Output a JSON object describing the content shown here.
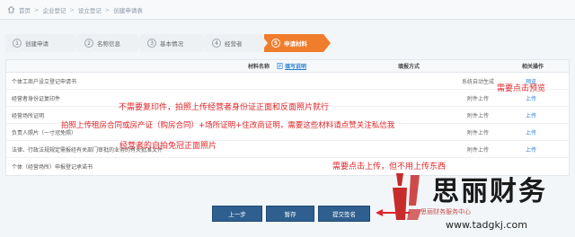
{
  "breadcrumb": {
    "items": [
      "首页",
      "企业登记",
      "设立登记",
      "创建申请表"
    ],
    "separator": ">"
  },
  "steps": [
    {
      "num": "1",
      "label": "创建申请"
    },
    {
      "num": "2",
      "label": "名称信息"
    },
    {
      "num": "3",
      "label": "基本情况"
    },
    {
      "num": "4",
      "label": "经营者"
    },
    {
      "num": "5",
      "label": "申请材料"
    }
  ],
  "active_step": 4,
  "table": {
    "headers": {
      "name": "材料名称",
      "guide": "填写说明",
      "method": "填报方式",
      "action": "相关操作"
    },
    "rows": [
      {
        "name": "个体工商户设立登记申请书",
        "method": "系统自动生成",
        "action": "预览"
      },
      {
        "name": "经营者身份证复印件",
        "method": "附件上传",
        "action": "上传"
      },
      {
        "name": "经营场所证明",
        "method": "附件上传",
        "action": "上传"
      },
      {
        "name": "负责人照片（一寸冠免照）",
        "method": "附件上传",
        "action": "上传"
      },
      {
        "name": "法律、行政法规规定需报经有关部门审批的业务的有关批准文件",
        "method": "附件上传",
        "action": "上传"
      },
      {
        "name": "个体（经营场所）申报登记承诺书",
        "method": "",
        "action": ""
      }
    ]
  },
  "annotations": {
    "preview": "需要点击预览",
    "id_copy": "不需要复印件，拍照上传经营者身份证正面和反面照片就行",
    "premises": "拍照上传租房合同或房产证（购房合同）+场所证明+住改商证明，需要这些材料请点赞关注私信我",
    "photo": "经营者的自拍免冠正面照片",
    "upload_note": "需要点击上传，但不用上传东西"
  },
  "buttons": {
    "prev": "上一步",
    "save": "暂存",
    "submit": "提交签名"
  },
  "watermark": {
    "name": "思丽财务",
    "url": "www.tadgkj.com",
    "sub": "思丽财务服务中心"
  },
  "colors": {
    "accent": "#f07d2c",
    "button": "#2e5f8f",
    "annotation": "#e0262a",
    "link": "#2a7fd4"
  }
}
